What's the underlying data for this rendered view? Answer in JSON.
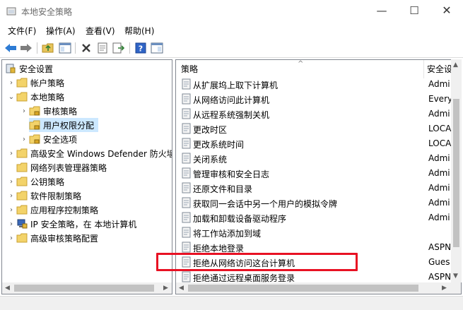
{
  "window": {
    "title": "本地安全策略",
    "minimize_glyph": "—",
    "maximize_glyph": "☐",
    "close_glyph": "✕"
  },
  "menu": [
    "文件(F)",
    "操作(A)",
    "查看(V)",
    "帮助(H)"
  ],
  "toolbar": {
    "icons": [
      "back-arrow-icon",
      "forward-arrow-icon",
      "up-folder-icon",
      "show-hide-tree-icon",
      "delete-icon",
      "properties-icon",
      "export-list-icon",
      "help-icon",
      "show-hide-action-pane-icon"
    ]
  },
  "tree": {
    "root": "安全设置",
    "items": [
      {
        "label": "帐户策略",
        "twisty": "›"
      },
      {
        "label": "本地策略",
        "twisty": "⌄"
      },
      {
        "label": "审核策略",
        "twisty": "›"
      },
      {
        "label": "用户权限分配",
        "twisty": "",
        "selected": true
      },
      {
        "label": "安全选项",
        "twisty": "›"
      },
      {
        "label": "高级安全 Windows Defender 防火墙",
        "twisty": "›"
      },
      {
        "label": "网络列表管理器策略",
        "twisty": ""
      },
      {
        "label": "公钥策略",
        "twisty": "›"
      },
      {
        "label": "软件限制策略",
        "twisty": "›"
      },
      {
        "label": "应用程序控制策略",
        "twisty": "›"
      },
      {
        "label": "IP 安全策略，在 本地计算机",
        "twisty": "›"
      },
      {
        "label": "高级审核策略配置",
        "twisty": "›"
      }
    ]
  },
  "list": {
    "col_policy": "策略",
    "col_setting": "安全设",
    "sort_glyph": "^",
    "rows": [
      {
        "name": "从扩展坞上取下计算机",
        "setting": "Admi"
      },
      {
        "name": "从网络访问此计算机",
        "setting": "Every"
      },
      {
        "name": "从远程系统强制关机",
        "setting": "Admi"
      },
      {
        "name": "更改时区",
        "setting": "LOCA"
      },
      {
        "name": "更改系统时间",
        "setting": "LOCA"
      },
      {
        "name": "关闭系统",
        "setting": "Admi"
      },
      {
        "name": "管理审核和安全日志",
        "setting": "Admi"
      },
      {
        "name": "还原文件和目录",
        "setting": "Admi"
      },
      {
        "name": "获取同一会话中另一个用户的模拟令牌",
        "setting": "Admi"
      },
      {
        "name": "加载和卸载设备驱动程序",
        "setting": "Admi"
      },
      {
        "name": "将工作站添加到域",
        "setting": ""
      },
      {
        "name": "拒绝本地登录",
        "setting": "ASPN"
      },
      {
        "name": "拒绝从网络访问这台计算机",
        "setting": "Gues"
      },
      {
        "name": "拒绝通过远程桌面服务登录",
        "setting": "ASPN"
      }
    ]
  },
  "scroll": {
    "up": "▲",
    "down": "▼",
    "left": "◀",
    "right": "▶"
  },
  "colors": {
    "highlight": "#e81123",
    "selection": "#cce8ff"
  }
}
